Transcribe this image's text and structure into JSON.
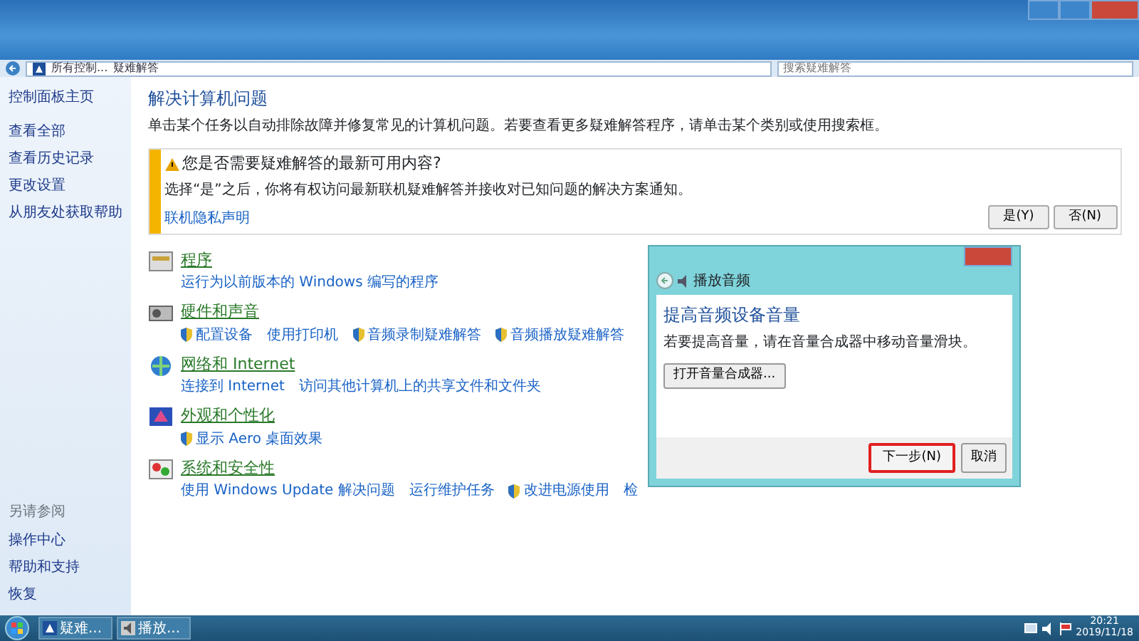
{
  "address_bar": {
    "breadcrumb": [
      "所有控制...",
      "疑难解答"
    ],
    "search": {
      "placeholder": "搜索疑难解答"
    }
  },
  "sidebar": {
    "home": "控制面板主页",
    "items": [
      "查看全部",
      "查看历史记录",
      "更改设置",
      "从朋友处获取帮助"
    ],
    "see_also": {
      "heading": "另请参阅",
      "items": [
        "操作中心",
        "帮助和支持",
        "恢复"
      ]
    }
  },
  "main": {
    "title": "解决计算机问题",
    "description": "单击某个任务以自动排除故障并修复常见的计算机问题。若要查看更多疑难解答程序，请单击某个类别或使用搜索框。",
    "notice": {
      "title": "您是否需要疑难解答的最新可用内容?",
      "text": "选择“是”之后，你将有权访问最新联机疑难解答并接收对已知问题的解决方案通知。",
      "link": "联机隐私声明",
      "buttons": [
        "是(Y)",
        "否(N)"
      ]
    },
    "categories": [
      {
        "kind": "programs",
        "title": "程序",
        "links": [
          {
            "label": "运行为以前版本的 Windows 编写的程序",
            "shield": false
          }
        ]
      },
      {
        "kind": "hardware",
        "title": "硬件和声音",
        "links": [
          {
            "label": "配置设备",
            "shield": true
          },
          {
            "label": "使用打印机",
            "shield": false
          },
          {
            "label": "音频录制疑难解答",
            "shield": true
          },
          {
            "label": "音频播放疑难解答",
            "shield": true
          }
        ]
      },
      {
        "kind": "network",
        "title": "网络和 Internet",
        "links": [
          {
            "label": "连接到 Internet",
            "shield": false
          },
          {
            "label": "访问其他计算机上的共享文件和文件夹",
            "shield": false
          }
        ]
      },
      {
        "kind": "appearance",
        "title": "外观和个性化",
        "links": [
          {
            "label": "显示 Aero 桌面效果",
            "shield": true
          }
        ]
      },
      {
        "kind": "security",
        "title": "系统和安全性",
        "links": [
          {
            "label": "使用 Windows Update 解决问题",
            "shield": false
          },
          {
            "label": "运行维护任务",
            "shield": false
          },
          {
            "label": "改进电源使用",
            "shield": true
          },
          {
            "label": "检",
            "shield": false
          }
        ]
      }
    ]
  },
  "dialog": {
    "title": "播放音频",
    "heading": "提高音频设备音量",
    "text": "若要提高音量，请在音量合成器中移动音量滑块。",
    "action": "打开音量合成器...",
    "buttons": [
      {
        "label": "下一步(N)",
        "highlighted": true
      },
      {
        "label": "取消",
        "highlighted": false
      }
    ]
  },
  "taskbar": {
    "items": [
      "疑难...",
      "播放..."
    ],
    "time": "20:21",
    "date": "2019/11/18"
  }
}
